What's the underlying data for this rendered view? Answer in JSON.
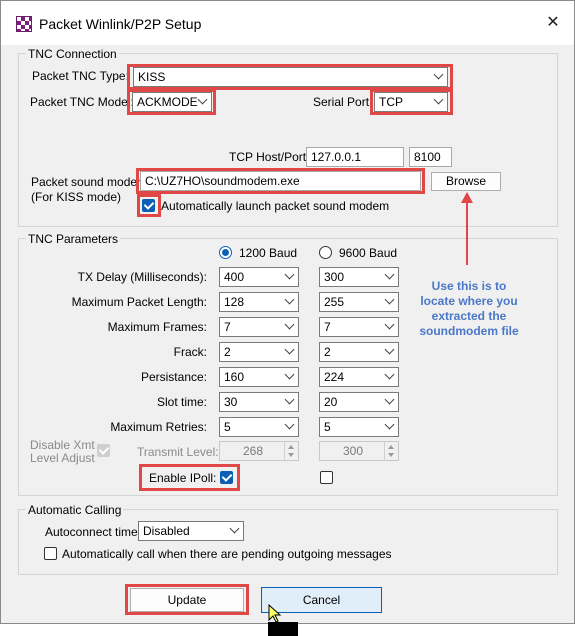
{
  "window": {
    "title": "Packet Winlink/P2P Setup",
    "close_glyph": "✕"
  },
  "tnc_connection": {
    "group_label": "TNC Connection",
    "type_label": "Packet TNC Type:",
    "type_value": "KISS",
    "model_label": "Packet TNC Model:",
    "model_value": "ACKMODE",
    "port_label": "Serial Port:",
    "port_value": "TCP",
    "hostport_label": "TCP Host/Port:",
    "host_value": "127.0.0.1",
    "port_number": "8100",
    "modem_label": "Packet sound modem:",
    "modem_sublabel": "(For KISS mode)",
    "modem_path": "C:\\UZ7HO\\soundmodem.exe",
    "browse_label": "Browse",
    "auto_launch_label": "Automatically launch packet sound modem",
    "auto_launch_checked": true
  },
  "tnc_parameters": {
    "group_label": "TNC Parameters",
    "baud_1200_label": "1200 Baud",
    "baud_9600_label": "9600 Baud",
    "selected_baud": "1200",
    "rows": [
      {
        "label": "TX Delay (Milliseconds):",
        "v1200": "400",
        "v9600": "300"
      },
      {
        "label": "Maximum Packet Length:",
        "v1200": "128",
        "v9600": "255"
      },
      {
        "label": "Maximum Frames:",
        "v1200": "7",
        "v9600": "7"
      },
      {
        "label": "Frack:",
        "v1200": "2",
        "v9600": "2"
      },
      {
        "label": "Persistance:",
        "v1200": "160",
        "v9600": "224"
      },
      {
        "label": "Slot time:",
        "v1200": "30",
        "v9600": "20"
      },
      {
        "label": "Maximum Retries:",
        "v1200": "5",
        "v9600": "5"
      }
    ],
    "disable_xmt_label_1": "Disable Xmt",
    "disable_xmt_label_2": "Level Adjust",
    "transmit_level_label": "Transmit Level:",
    "transmit_level_1200": "268",
    "transmit_level_9600": "300",
    "enable_ipoll_label": "Enable IPoll:",
    "ipoll_1200_checked": true,
    "ipoll_9600_checked": false
  },
  "automatic_calling": {
    "group_label": "Automatic Calling",
    "autoconnect_label": "Autoconnect time:",
    "autoconnect_value": "Disabled",
    "auto_call_label": "Automatically call when there are pending outgoing messages",
    "auto_call_checked": false
  },
  "buttons": {
    "update_label": "Update",
    "cancel_label": "Cancel"
  },
  "annotation": {
    "line1": "Use this is to",
    "line2": "locate where you",
    "line3": "extracted the",
    "line4": "soundmodem file"
  },
  "colors": {
    "highlight": "#e04848",
    "note": "#4a78c8",
    "accent": "#0a5fb4"
  }
}
